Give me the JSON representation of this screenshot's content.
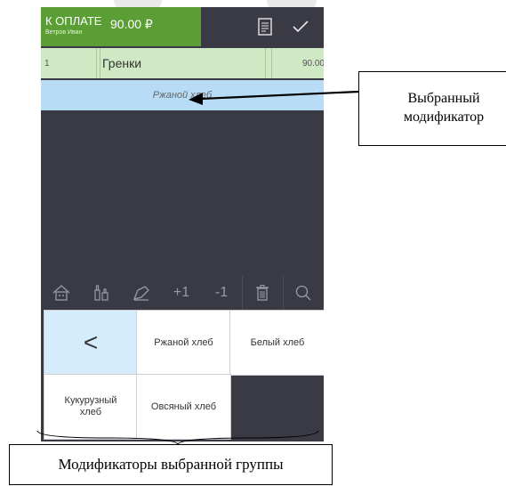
{
  "header": {
    "pay_label": "К ОПЛАТЕ",
    "customer": "Ветров Иван",
    "amount": "90.00 ₽",
    "receipt_icon": "receipt-icon",
    "confirm_icon": "checkmark-icon"
  },
  "order": {
    "qty": "1",
    "name": "Гренки",
    "price": "90.00",
    "modifier": "Ржаной хлеб"
  },
  "toolbar": {
    "items": [
      "home-icon",
      "bottles-icon",
      "edit-icon",
      "+1",
      "-1",
      "trash-icon",
      "search-icon"
    ]
  },
  "modifiers": {
    "back_glyph": "<",
    "items": [
      "Ржаной хлеб",
      "Белый хлеб",
      "Кукурузный хлеб",
      "Овсяный хлеб"
    ]
  },
  "annotations": {
    "selected_modifier": "Выбранный модификатор",
    "group_modifiers": "Модификаторы выбранной группы"
  },
  "colors": {
    "pay_green": "#5a9e35",
    "order_row": "#cfe9c5",
    "modifier_row": "#b9dcf6",
    "screen_bg": "#3a3a45",
    "back_key": "#d4ecfb"
  }
}
